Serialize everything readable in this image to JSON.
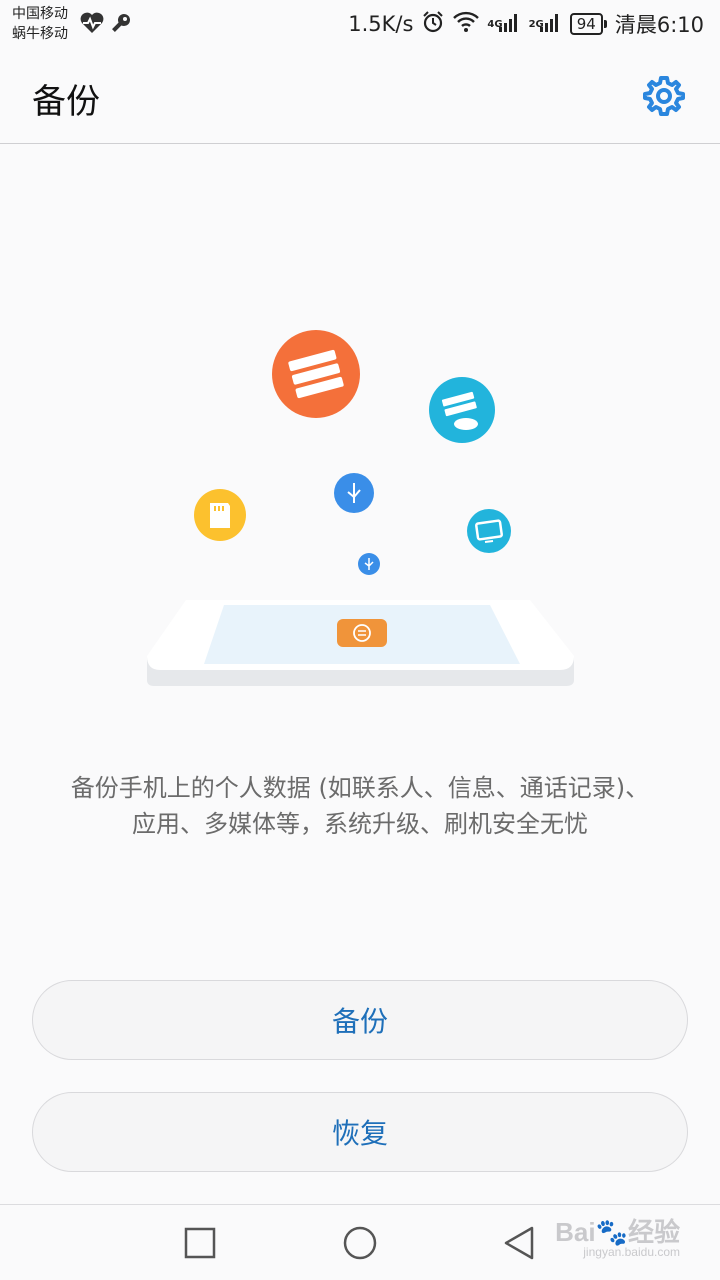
{
  "status_bar": {
    "carrier_1": "中国移动",
    "carrier_2": "蜗牛移动",
    "net_speed": "1.5K/s",
    "net_4g": "4G",
    "net_2g": "2G",
    "battery": "94",
    "time": "清晨6:10",
    "icons": [
      "heart-pulse-icon",
      "key-icon",
      "alarm-icon",
      "wifi-icon",
      "signal-icon",
      "signal-icon",
      "battery-icon"
    ]
  },
  "app_bar": {
    "title": "备份",
    "settings_icon": "gear-icon"
  },
  "illustration": {
    "icons": [
      "server-icon",
      "cloud-server-icon",
      "sd-card-icon",
      "usb-icon",
      "monitor-icon",
      "usb-icon",
      "backup-restore-icon"
    ],
    "colors": {
      "orange": "#f4703a",
      "cyan": "#22b4dc",
      "yellow": "#fcc12e",
      "blue": "#3a8ee8",
      "phone_screen": "#e8f3fb",
      "backup_orange": "#f0943a"
    }
  },
  "description": {
    "line1": "备份手机上的个人数据 (如联系人、信息、通话记录)、",
    "line2": "应用、多媒体等，系统升级、刷机安全无忧"
  },
  "buttons": {
    "backup_label": "备份",
    "restore_label": "恢复"
  },
  "nav_bar": {
    "icons": [
      "recents-square-icon",
      "home-circle-icon",
      "back-triangle-icon"
    ]
  },
  "watermark": {
    "logo_text": "Bai🐾经验",
    "url": "jingyan.baidu.com"
  },
  "theme": {
    "accent": "#1e6fb9",
    "background": "#fafafb"
  }
}
